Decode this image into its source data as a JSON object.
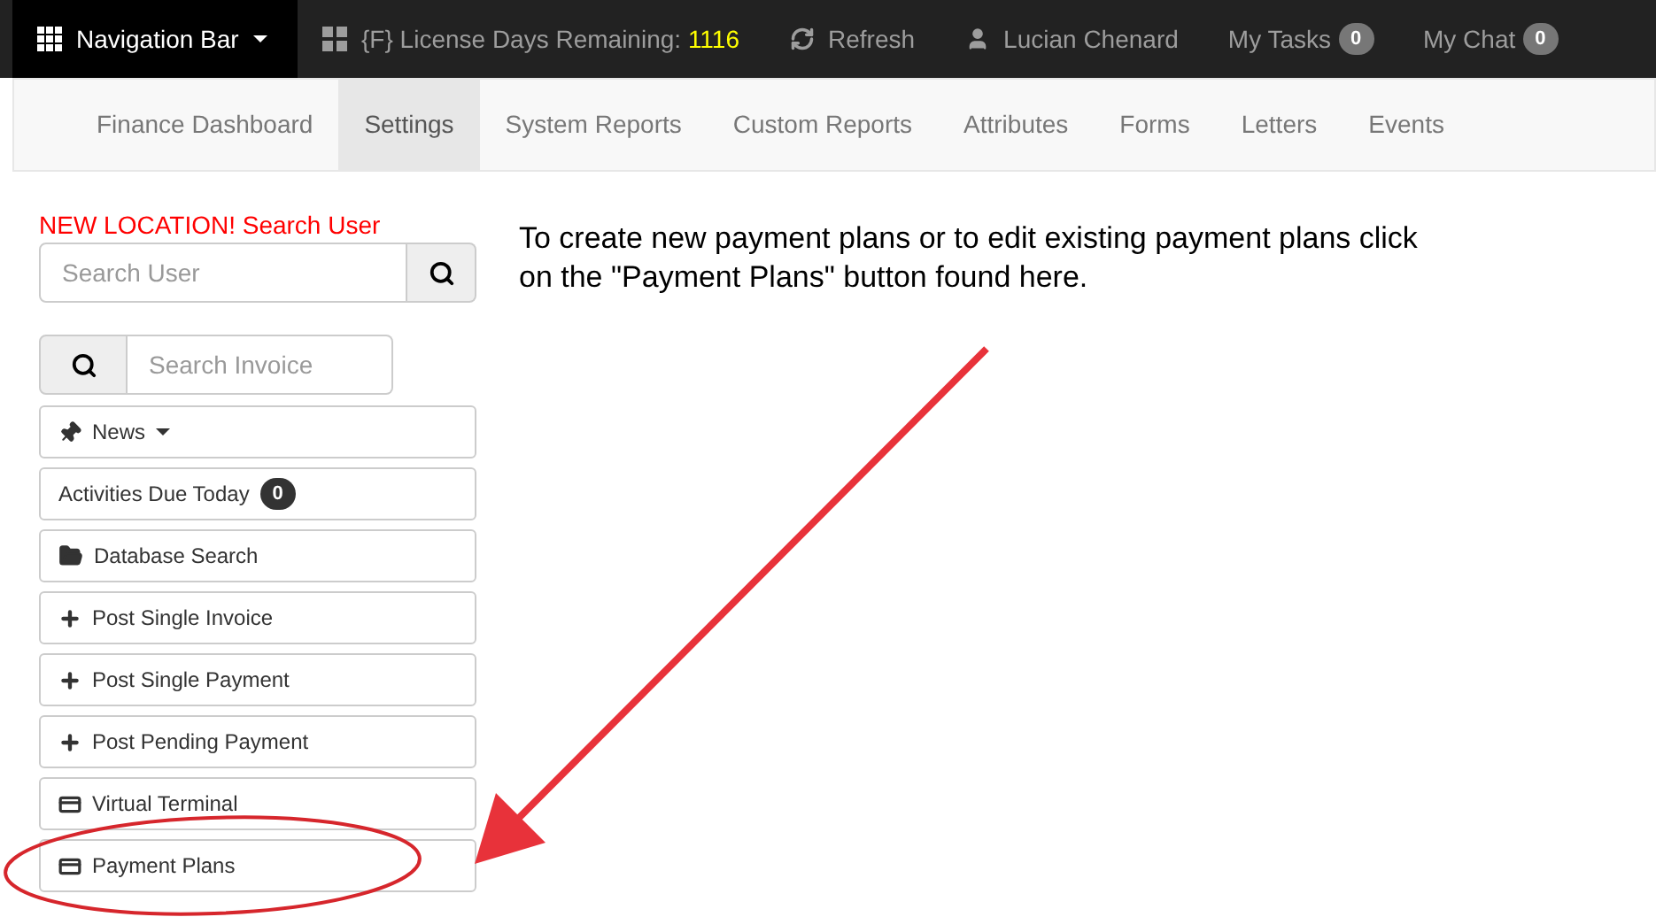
{
  "top_bar": {
    "brand": "Navigation Bar",
    "license_label": "{F} License Days Remaining:",
    "license_days": "1116",
    "refresh": "Refresh",
    "user": "Lucian Chenard",
    "tasks": {
      "label": "My Tasks",
      "count": "0"
    },
    "chat": {
      "label": "My Chat",
      "count": "0"
    }
  },
  "tabs": [
    {
      "label": "Finance Dashboard",
      "selected": false
    },
    {
      "label": "Settings",
      "selected": true
    },
    {
      "label": "System Reports",
      "selected": false
    },
    {
      "label": "Custom Reports",
      "selected": false
    },
    {
      "label": "Attributes",
      "selected": false
    },
    {
      "label": "Forms",
      "selected": false
    },
    {
      "label": "Letters",
      "selected": false
    },
    {
      "label": "Events",
      "selected": false
    }
  ],
  "sidebar": {
    "notice": "NEW LOCATION! Search User",
    "user_search": {
      "placeholder": "Search User"
    },
    "invoice_search": {
      "placeholder": "Search Invoice"
    },
    "items": [
      {
        "kind": "dropdown",
        "label": "News"
      },
      {
        "kind": "badge",
        "label": "Activities Due Today",
        "count": "0"
      },
      {
        "kind": "folder",
        "label": "Database Search"
      },
      {
        "kind": "plus",
        "label": "Post Single Invoice"
      },
      {
        "kind": "plus",
        "label": "Post Single Payment"
      },
      {
        "kind": "plus",
        "label": "Post Pending Payment"
      },
      {
        "kind": "card",
        "label": "Virtual Terminal"
      },
      {
        "kind": "card",
        "label": "Payment Plans",
        "highlighted": true
      }
    ]
  },
  "instruction": "To create new payment plans or to edit existing payment plans click on the \"Payment Plans\" button found here."
}
